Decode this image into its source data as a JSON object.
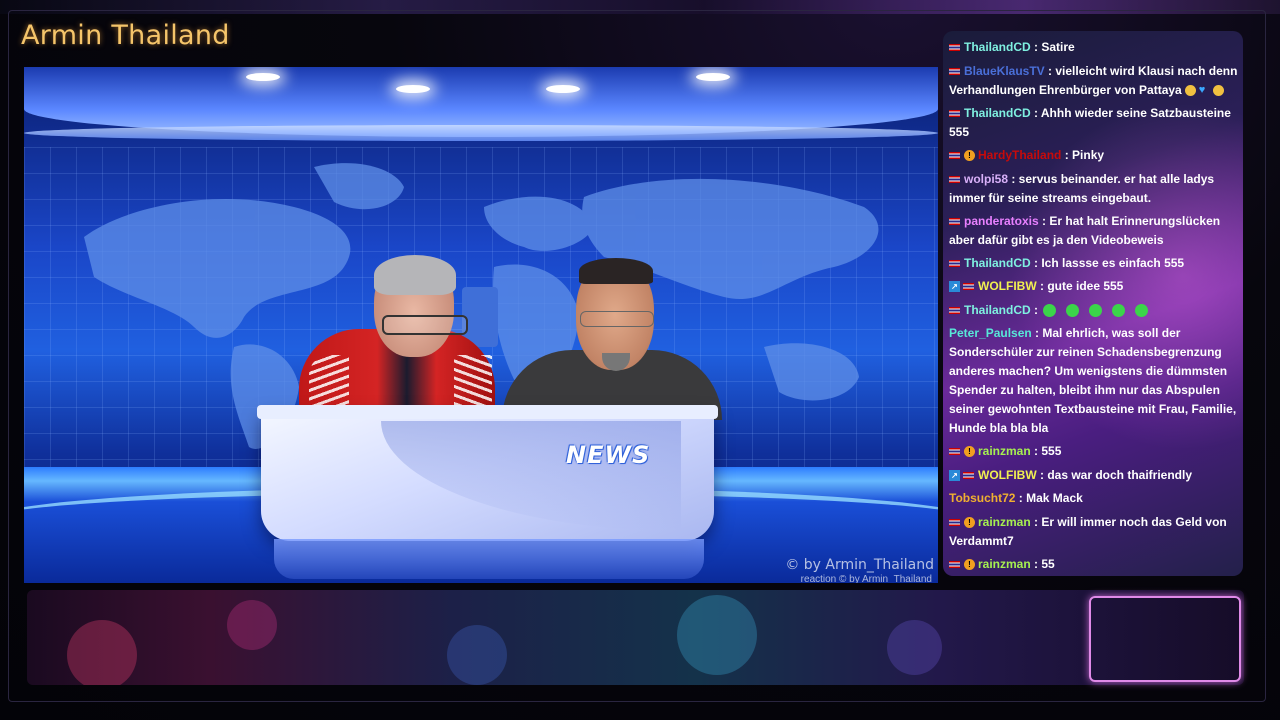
{
  "channel": {
    "title": "Armin Thailand"
  },
  "video": {
    "desk_logo": "NEWS",
    "watermark": "© by Armin_Thailand",
    "watermark_sub": "reaction  © by Armin_Thailand"
  },
  "chat": {
    "messages": [
      {
        "user": "ThailandCD",
        "text": " : Satire"
      },
      {
        "user": "BlaueKlausTV",
        "text": " : vielleicht wird Klausi nach denn Verhandlungen Ehrenbürger von Pattaya"
      },
      {
        "user": "ThailandCD",
        "text": " : Ahhh wieder seine Satzbausteine 555"
      },
      {
        "user": "HardyThailand",
        "text": " : Pinky"
      },
      {
        "user": "wolpi58",
        "text": " : servus beinander. er hat alle ladys immer für seine streams eingebaut."
      },
      {
        "user": "panderatoxis",
        "text": " : Er hat halt Erinnerungslücken aber dafür gibt es ja den Videobeweis"
      },
      {
        "user": "ThailandCD",
        "text": " : Ich lassse es einfach 555"
      },
      {
        "user": "WOLFIBW",
        "text": " : gute idee 555"
      },
      {
        "user": "ThailandCD",
        "text": " :"
      },
      {
        "user": "Peter_Paulsen",
        "text": " : Mal ehrlich, was soll der Sonderschüler zur reinen Schadensbegrenzung anderes machen? Um wenigstens die dümmsten Spender zu halten, bleibt ihm nur das Abspulen seiner gewohnten Textbausteine mit Frau, Familie, Hunde bla bla bla"
      },
      {
        "user": "rainzman",
        "text": " : 555"
      },
      {
        "user": "WOLFIBW",
        "text": " : das war doch thaifriendly"
      },
      {
        "user": "Tobsucht72",
        "text": " : Mak Mack"
      },
      {
        "user": "rainzman",
        "text": " : Er will immer noch das Geld von Verdammt7"
      },
      {
        "user": "rainzman",
        "text": " : 55"
      }
    ]
  },
  "colors": {
    "title": "#f5c56a",
    "chat_bg": "#4a1e80",
    "studio_blue": "#1a46c8"
  },
  "icons": [
    "thai-flag-icon",
    "moderator-badge-icon",
    "prime-badge-icon",
    "green-emote-icon",
    "smile-emoji-icon",
    "heart-emoji-icon"
  ]
}
